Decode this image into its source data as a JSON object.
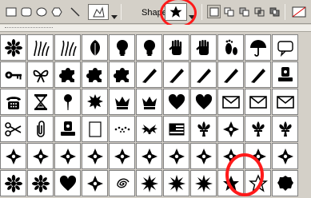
{
  "options": {
    "shape_label": "Shape:",
    "tools": [
      {
        "name": "rectangle-tool-icon"
      },
      {
        "name": "rounded-rectangle-tool-icon"
      },
      {
        "name": "ellipse-tool-icon"
      },
      {
        "name": "polygon-tool-icon"
      },
      {
        "name": "line-tool-icon"
      },
      {
        "name": "custom-shape-tool-icon"
      }
    ],
    "selected_shape": "star-icon",
    "modes": [
      "new-layer-icon",
      "add-to-area-icon",
      "subtract-icon",
      "intersect-icon",
      "exclude-icon"
    ]
  },
  "picker": {
    "rows": [
      [
        "flower-icon",
        "grass-icon",
        "grass-icon",
        "leaf-icon",
        "lightbulb-icon",
        "lightbulb-icon",
        "hand-icon",
        "hand-icon",
        "footprint-icon",
        "umbrella-icon",
        "talk-icon"
      ],
      [
        "key-icon",
        "bow-icon",
        "puzzle-icon",
        "puzzle-icon",
        "puzzle-icon",
        "pen-icon",
        "pen-icon",
        "pen-icon",
        "pen-icon",
        "pen-icon",
        "stamp-icon"
      ],
      [
        "phone-icon",
        "hourglass-icon",
        "pin-icon",
        "sun-badge-icon",
        "crown-icon",
        "crown-icon",
        "heart-icon",
        "heart-icon",
        "envelope-icon",
        "envelope-icon",
        "envelope-icon"
      ],
      [
        "scissors-icon",
        "paperclip-icon",
        "stamp-icon",
        "frame-icon",
        "dots-icon",
        "holly-icon",
        "flag-icon",
        "fleur-de-lis-icon",
        "ornament-icon",
        "fleur-de-lis-icon",
        "fleur-de-lis-icon"
      ],
      [
        "ornament-icon",
        "ornament-icon",
        "ornament-icon",
        "ornament-icon",
        "ornament-icon",
        "ornament-icon",
        "ornament-icon",
        "ornament-icon",
        "ornament-icon",
        "ornament-icon",
        "ornament-icon"
      ],
      [
        "flower-icon",
        "flower-icon",
        "heart-icon",
        "ornament-icon",
        "spiral-icon",
        "burst-icon",
        "burst-icon",
        "burst-icon",
        "star-icon",
        "star-outline-icon",
        "badge-icon"
      ]
    ]
  }
}
